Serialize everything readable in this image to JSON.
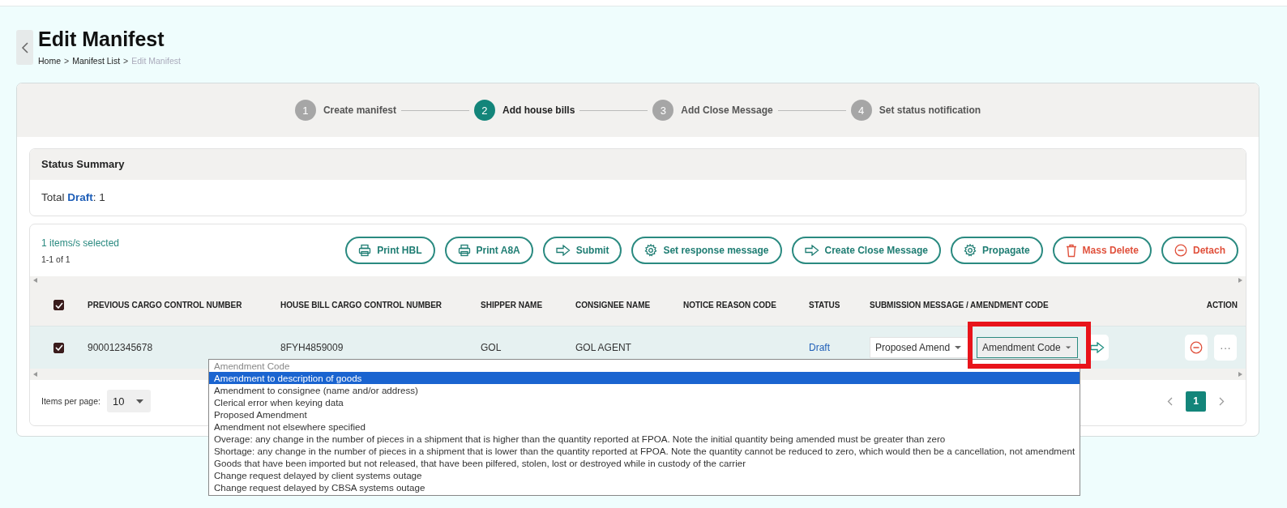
{
  "header": {
    "title": "Edit Manifest",
    "breadcrumb_separator": ">",
    "breadcrumb": [
      {
        "label": "Home",
        "current": false
      },
      {
        "label": "Manifest List",
        "current": false
      },
      {
        "label": "Edit Manifest",
        "current": true
      }
    ]
  },
  "steps": [
    {
      "number": "1",
      "label": "Create manifest",
      "selected": false
    },
    {
      "number": "2",
      "label": "Add house bills",
      "selected": true
    },
    {
      "number": "3",
      "label": "Add Close Message",
      "selected": false
    },
    {
      "number": "4",
      "label": "Set status notification",
      "selected": false
    }
  ],
  "status_summary": {
    "title": "Status Summary",
    "prefix": "Total",
    "status": "Draft",
    "suffix": ": 1"
  },
  "toolbar": {
    "selected_text": "1 items/s selected",
    "range": "1-1 of 1",
    "buttons": [
      {
        "label": "Print HBL",
        "kind": "default"
      },
      {
        "label": "Print A8A",
        "kind": "default"
      },
      {
        "label": "Submit",
        "kind": "default"
      },
      {
        "label": "Set response message",
        "kind": "default"
      },
      {
        "label": "Create Close Message",
        "kind": "default"
      },
      {
        "label": "Propagate",
        "kind": "default"
      },
      {
        "label": "Mass Delete",
        "kind": "danger"
      },
      {
        "label": "Detach",
        "kind": "danger"
      }
    ]
  },
  "table": {
    "header_checked": true,
    "columns": [
      "PREVIOUS CARGO CONTROL NUMBER",
      "HOUSE BILL CARGO CONTROL NUMBER",
      "SHIPPER NAME",
      "CONSIGNEE NAME",
      "NOTICE REASON CODE",
      "STATUS",
      "SUBMISSION MESSAGE / AMENDMENT CODE",
      "ACTION"
    ],
    "rows": [
      {
        "checked": true,
        "previous_ccn": "900012345678",
        "house_bill_ccn": "8FYH4859009",
        "shipper": "GOL",
        "consignee": "GOL AGENT",
        "status": "Draft",
        "submission_message": "Proposed Amend",
        "amendment_code": "Amendment Code",
        "amendment_code_highlighted": true,
        "more": "···"
      }
    ]
  },
  "pagination": {
    "items_per_page_label": "Items per page:",
    "items_per_page": "10",
    "pages": [
      {
        "label": "1",
        "selected": true
      }
    ]
  },
  "dropdown": {
    "placeholder": "Amendment Code",
    "options": [
      {
        "label": "Amendment to description of goods",
        "selected": true
      },
      {
        "label": "Amendment to consignee (name and/or address)",
        "selected": false
      },
      {
        "label": "Clerical error when keying data",
        "selected": false
      },
      {
        "label": "Proposed Amendment",
        "selected": false
      },
      {
        "label": "Amendment not elsewhere specified",
        "selected": false
      },
      {
        "label": "Overage: any change in the number of pieces in a shipment that is higher than the quantity reported at FPOA. Note the initial quantity being amended must be greater than zero",
        "selected": false
      },
      {
        "label": "Shortage: any change in the number of pieces in a shipment that is lower than the quantity reported at FPOA. Note the quantity cannot be reduced to zero, which would then be a cancellation, not amendment",
        "selected": false
      },
      {
        "label": "Goods that have been imported but not released, that have been pilfered, stolen, lost or destroyed while in custody of the carrier",
        "selected": false
      },
      {
        "label": "Change request delayed by client systems outage",
        "selected": false
      },
      {
        "label": "Change request delayed by CBSA systems outage",
        "selected": false
      }
    ]
  }
}
